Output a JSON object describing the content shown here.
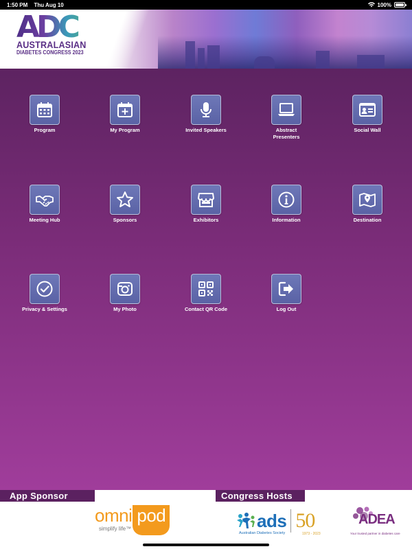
{
  "status_bar": {
    "time": "1:50 PM",
    "date": "Thu Aug 10",
    "battery_pct": "100%",
    "battery_level": 1.0
  },
  "banner": {
    "logo_mark": "ADC",
    "logo_line1": "AUSTRALASIAN",
    "logo_line2": "DIABETES CONGRESS 2023"
  },
  "tiles": [
    {
      "label": "Program",
      "icon": "calendar-icon"
    },
    {
      "label": "My Program",
      "icon": "calendar-plus-icon"
    },
    {
      "label": "Invited Speakers",
      "icon": "microphone-icon"
    },
    {
      "label": "Abstract Presenters",
      "icon": "laptop-icon"
    },
    {
      "label": "Social Wall",
      "icon": "id-card-icon"
    },
    {
      "label": "Meeting Hub",
      "icon": "handshake-icon"
    },
    {
      "label": "Sponsors",
      "icon": "star-icon"
    },
    {
      "label": "Exhibitors",
      "icon": "store-icon"
    },
    {
      "label": "Information",
      "icon": "info-icon"
    },
    {
      "label": "Destination",
      "icon": "map-icon"
    },
    {
      "label": "Privacy & Settings",
      "icon": "check-circle-icon"
    },
    {
      "label": "My Photo",
      "icon": "camera-icon"
    },
    {
      "label": "Contact QR Code",
      "icon": "qr-code-icon"
    },
    {
      "label": "Log Out",
      "icon": "logout-icon"
    }
  ],
  "footer": {
    "sponsor_heading": "App Sponsor",
    "hosts_heading": "Congress Hosts",
    "omnipod": {
      "omni": "omni",
      "pod": "pod",
      "tagline": "simplify life™"
    },
    "ads": {
      "name": "ads",
      "full_name": "Australian Diabetes Society",
      "fifty": "50",
      "years": "1973 - 2023"
    },
    "adea": {
      "name": "ADEA",
      "tagline": "Your trusted partner in diabetes care"
    }
  },
  "colors": {
    "main_top": "#5d2361",
    "main_bottom": "#a03d9b",
    "tile_bg": "#6470b0",
    "tag_bg": "#5b2160",
    "omnipod_orange": "#f39a1d",
    "ads_blue": "#1d6fb8",
    "adea_purple": "#7a2e80"
  }
}
